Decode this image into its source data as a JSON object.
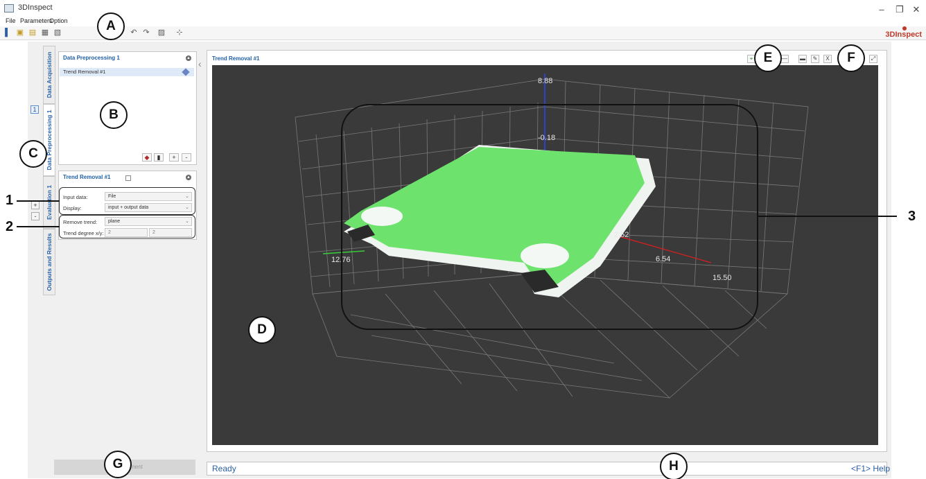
{
  "window": {
    "title": "3DInspect",
    "minimize": "–",
    "maximize": "❐",
    "close": "✕"
  },
  "menu": [
    "File",
    "Parameters",
    "Option"
  ],
  "toolbar_icons": [
    "measure-icon",
    "open-icon",
    "open-folder-icon",
    "save-icon",
    "save-as-icon",
    "undo-icon",
    "redo-icon",
    "export-icon",
    "settings-icon"
  ],
  "brand": "3DInspect",
  "side_tabs": [
    "Data Acquisition",
    "Data Preprocessing 1",
    "Evaluation 1",
    "Outputs and Results"
  ],
  "page_number": "1",
  "add_label": "+",
  "remove_label": "-",
  "preprocessing": {
    "title": "Data Preprocessing 1",
    "items": [
      "Trend Removal #1"
    ],
    "add_label": "+",
    "remove_label": "-"
  },
  "trend_panel": {
    "title": "Trend Removal #1",
    "input_data_label": "Input data:",
    "input_data_value": "File",
    "display_label": "Display:",
    "display_value": "input + output data",
    "remove_trend_label": "Remove trend:",
    "remove_trend_value": "plane",
    "trend_degree_label": "Trend degree x/y:",
    "trend_degree_x": "2",
    "trend_degree_y": "2"
  },
  "view": {
    "title": "Trend Removal #1",
    "z_top": "8.88",
    "z_mid": "-0.18",
    "axis_a": "12.76",
    "axis_b": "2.52",
    "axis_c": "6.54",
    "axis_d": "15.50"
  },
  "callouts": {
    "A": "A",
    "B": "B",
    "C": "C",
    "D": "D",
    "E": "E",
    "F": "F",
    "G": "G",
    "H": "H"
  },
  "row_labels": {
    "one": "1",
    "two": "2",
    "three": "3"
  },
  "bottom_button": "ment",
  "status": "Ready",
  "help": "<F1> Help",
  "colors": {
    "accent": "#1f5fa8",
    "surface_green": "#6de36d",
    "view_bg": "#3a3a3a"
  }
}
